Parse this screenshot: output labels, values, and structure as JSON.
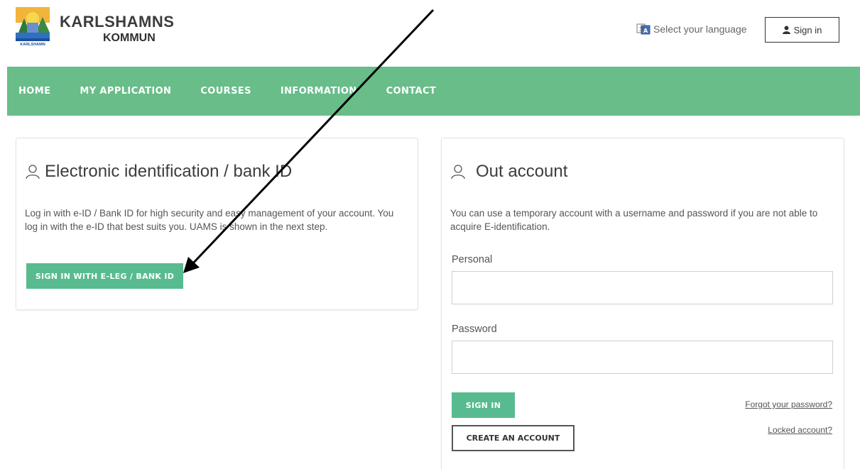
{
  "header": {
    "brand_line1": "KARLSHAMNS",
    "brand_line2": "KOMMUN",
    "logo_text": "KARLSHAMN",
    "language_label": "Select your language",
    "signin_label": "Sign in"
  },
  "nav": {
    "items": [
      {
        "label": "HOME"
      },
      {
        "label": "MY APPLICATION"
      },
      {
        "label": "COURSES"
      },
      {
        "label": "INFORMATION"
      },
      {
        "label": "CONTACT"
      }
    ]
  },
  "eid_card": {
    "title": "Electronic identification / bank ID",
    "description": "Log in with e-ID / Bank ID for high security and easy management of your account. You log in with the e-ID that best suits you. UAMS is shown in the next step.",
    "button_label": "SIGN IN WITH E-LEG / BANK ID"
  },
  "account_card": {
    "title": "Out account",
    "description": "You can use a temporary account with a username and password if you are not able to acquire E-identification.",
    "personal_label": "Personal",
    "personal_value": "",
    "password_label": "Password",
    "password_value": "",
    "signin_button": "SIGN IN",
    "create_button": "CREATE AN ACCOUNT",
    "forgot_link": "Forgot your password?",
    "locked_link": "Locked account?"
  },
  "colors": {
    "nav_green": "#68bd89",
    "button_green": "#58bb8f"
  }
}
